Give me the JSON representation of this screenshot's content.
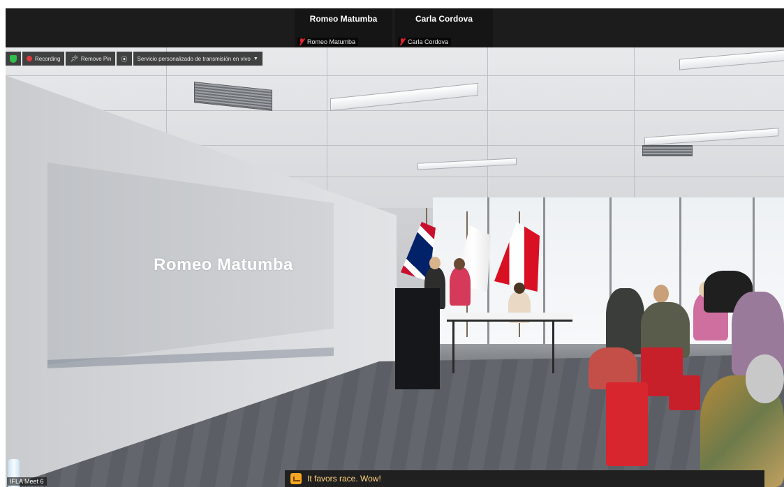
{
  "participants": [
    {
      "display_name": "Romeo Matumba",
      "tag_name": "Romeo Matumba",
      "muted_icon": "mic-muted-icon"
    },
    {
      "display_name": "Carla Cordova",
      "tag_name": "Carla Cordova",
      "muted_icon": "mic-muted-icon"
    }
  ],
  "toolbar": {
    "security_icon": "shield-icon",
    "recording_label": "Recording",
    "remove_pin_label": "Remove Pin",
    "live_icon": "live-stream-icon",
    "stream_service_label": "Servicio personalizado de transmisión en vivo"
  },
  "projection": {
    "speaker_name": "Romeo Matumba"
  },
  "caption": {
    "text": "It favors race. Wow!"
  },
  "self_view": {
    "label": "IFLA Meet 6"
  },
  "colors": {
    "security": "#2fbf4a",
    "recording": "#e03a3a",
    "caption_text": "#ffd27a",
    "chat_badge": "#f5a623",
    "muted": "#e02828"
  }
}
